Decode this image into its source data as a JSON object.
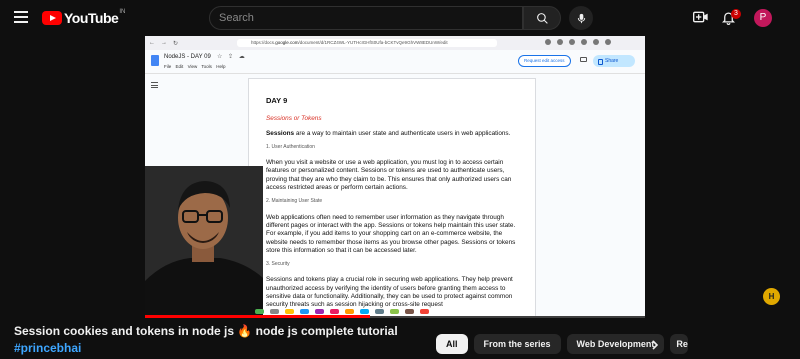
{
  "header": {
    "logo_text": "YouTube",
    "logo_country": "IN",
    "search_placeholder": "Search",
    "notification_count": "3",
    "avatar_letter": "P"
  },
  "browser": {
    "url_prefix": "https://docs.",
    "url_domain": "google.com",
    "url_rest": "/document/d/1RCZ4WL-YUTHcIGHfS0Ufa-bCKTvQe9GhVW8EDUnW/edit"
  },
  "docs": {
    "title": "NodeJS - DAY 09",
    "menu": [
      "File",
      "Edit",
      "View",
      "Tools",
      "Help"
    ],
    "request_edit": "Request edit access",
    "share": "Share",
    "heading": "DAY 9",
    "subtitle": "Sessions or Tokens",
    "intro_bold": "Sessions",
    "intro_rest": " are a way to maintain user state and authenticate users in web applications.",
    "section1": "1. User Authentication",
    "para1": "When you visit a website or use a web application, you must log in to access certain features or personalized content. Sessions or tokens are used to authenticate users, proving that they are who they claim to be. This ensures that only authorized users can access restricted areas or perform certain actions.",
    "section2": "2. Maintaining User State",
    "para2": "Web applications often need to remember user information as they navigate through different pages or interact with the app. Sessions or tokens help maintain this user state. For example, if you add items to your shopping cart on an e-commerce website, the website needs to remember those items as you browse other pages. Sessions or tokens store this information so that it can be accessed later.",
    "section3": "3. Security",
    "para3": "Sessions and tokens play a crucial role in securing web applications. They help prevent unauthorized access by verifying the identity of users before granting them access to sensitive data or functionality. Additionally, they can be used to protect against common security threats such as session hijacking or cross-site request"
  },
  "player": {
    "progress": 0.45,
    "channel_badge": "H"
  },
  "video": {
    "title": "Session cookies and tokens in node js 🔥 node js complete tutorial",
    "hashtag": "#princebhai"
  },
  "chips": [
    "All",
    "From the series",
    "Web Development",
    "Re"
  ],
  "colors": {
    "brand_red": "#ff0000",
    "link_blue": "#3ea6ff",
    "doc_accent_red": "#d93025"
  }
}
